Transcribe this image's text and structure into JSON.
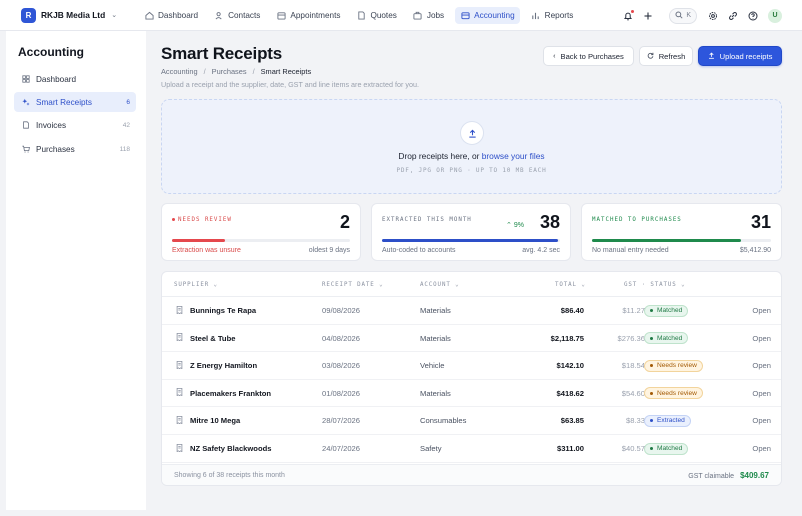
{
  "brand": {
    "initial": "R",
    "name": "RKJB Media Ltd"
  },
  "nav": [
    {
      "label": "Dashboard",
      "icon": "home-icon"
    },
    {
      "label": "Contacts",
      "icon": "contacts-icon"
    },
    {
      "label": "Appointments",
      "icon": "calendar-icon"
    },
    {
      "label": "Quotes",
      "icon": "document-icon"
    },
    {
      "label": "Jobs",
      "icon": "briefcase-icon"
    },
    {
      "label": "Accounting",
      "icon": "accounting-icon",
      "active": true
    },
    {
      "label": "Reports",
      "icon": "bar-chart-icon"
    }
  ],
  "topbar": {
    "search_shortcut": "K",
    "avatar_initial": "U"
  },
  "sidebar": {
    "title": "Accounting",
    "items": [
      {
        "label": "Dashboard",
        "count": "",
        "icon": "grid-icon"
      },
      {
        "label": "Smart Receipts",
        "count": "6",
        "icon": "sparkle-icon",
        "active": true
      },
      {
        "label": "Invoices",
        "count": "42",
        "icon": "file-icon"
      },
      {
        "label": "Purchases",
        "count": "118",
        "icon": "cart-icon"
      }
    ]
  },
  "page": {
    "title": "Smart Receipts",
    "breadcrumb": [
      "Accounting",
      "Purchases",
      "Smart Receipts"
    ],
    "subtitle": "Upload a receipt and the supplier, date, GST and line items are extracted for you.",
    "buttons": {
      "back": "Back to Purchases",
      "refresh": "Refresh",
      "upload": "Upload receipts"
    }
  },
  "dropzone": {
    "text": "Drop receipts here, or ",
    "link": "browse your files",
    "sub": "PDF, JPG OR PNG · UP TO 10 MB EACH"
  },
  "stats": [
    {
      "label": "NEEDS REVIEW",
      "value": "2",
      "delta": "",
      "fill": 0.3,
      "color": "#e5484d",
      "left": "Extraction was unsure",
      "right": "oldest 9 days"
    },
    {
      "label": "EXTRACTED THIS MONTH",
      "value": "38",
      "delta": "9%",
      "fill": 0.99,
      "color": "#2d4fc8",
      "left": "Auto-coded to accounts",
      "right": "avg. 4.2 sec"
    },
    {
      "label": "MATCHED TO PURCHASES",
      "value": "31",
      "fill": 0.83,
      "color": "#1f8a4c",
      "left": "No manual entry needed",
      "right": "$5,412.90"
    }
  ],
  "table": {
    "headers": {
      "supplier": "SUPPLIER",
      "date": "RECEIPT DATE",
      "account": "ACCOUNT",
      "total": "TOTAL",
      "gst": "GST",
      "status": "STATUS"
    },
    "rows": [
      {
        "supplier": "Bunnings Te Rapa",
        "date": "09/08/2026",
        "account": "Materials",
        "total": "$86.40",
        "gst": "$11.27",
        "status": "Matched",
        "action": "Open"
      },
      {
        "supplier": "Steel & Tube",
        "date": "04/08/2026",
        "account": "Materials",
        "total": "$2,118.75",
        "gst": "$276.36",
        "status": "Matched",
        "action": "Open"
      },
      {
        "supplier": "Z Energy Hamilton",
        "date": "03/08/2026",
        "account": "Vehicle",
        "total": "$142.10",
        "gst": "$18.54",
        "status": "Needs review",
        "action": "Open"
      },
      {
        "supplier": "Placemakers Frankton",
        "date": "01/08/2026",
        "account": "Materials",
        "total": "$418.62",
        "gst": "$54.60",
        "status": "Needs review",
        "action": "Open"
      },
      {
        "supplier": "Mitre 10 Mega",
        "date": "28/07/2026",
        "account": "Consumables",
        "total": "$63.85",
        "gst": "$8.33",
        "status": "Extracted",
        "action": "Open"
      },
      {
        "supplier": "NZ Safety Blackwoods",
        "date": "24/07/2026",
        "account": "Safety",
        "total": "$311.00",
        "gst": "$40.57",
        "status": "Matched",
        "action": "Open"
      }
    ],
    "footer": {
      "summary": "Showing 6 of 38 receipts this month",
      "gst_label": "GST claimable",
      "gst_value": "$409.67"
    }
  },
  "status_colors": {
    "Matched": {
      "fg": "#1f7a45",
      "bg": "#e8f6ee",
      "border": "#bfe3cc"
    },
    "Needs review": {
      "fg": "#a35a05",
      "bg": "#fff4e0",
      "border": "#f2d49c"
    },
    "Extracted": {
      "fg": "#2d4fc8",
      "bg": "#eaf0fd",
      "border": "#c4d3f5"
    }
  }
}
